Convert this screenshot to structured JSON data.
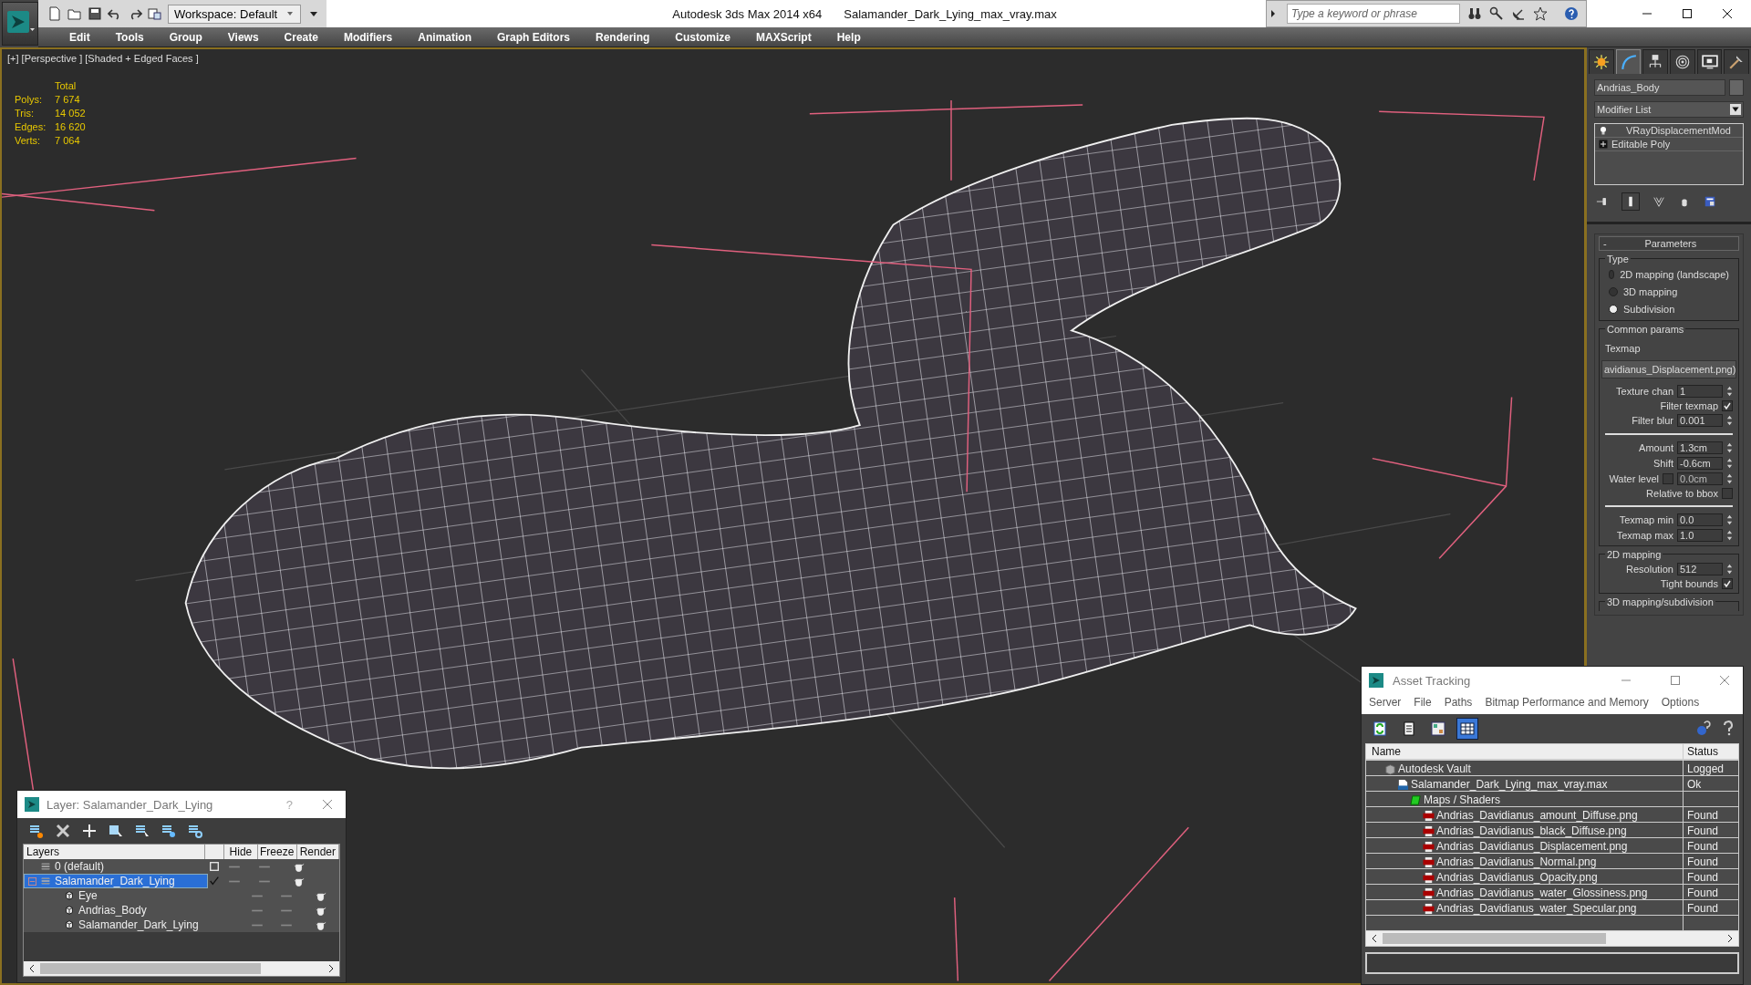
{
  "title_bar": {
    "workspace": "Workspace: Default",
    "app_title": "Autodesk 3ds Max  2014 x64",
    "file_title": "Salamander_Dark_Lying_max_vray.max",
    "search": {
      "placeholder": "Type a keyword or phrase"
    }
  },
  "menu": [
    "Edit",
    "Tools",
    "Group",
    "Views",
    "Create",
    "Modifiers",
    "Animation",
    "Graph Editors",
    "Rendering",
    "Customize",
    "MAXScript",
    "Help"
  ],
  "viewport": {
    "label": "[+] [Perspective ] [Shaded + Edged Faces ]",
    "stats": {
      "header": "Total",
      "rows": [
        {
          "label": "Polys:",
          "value": "7 674"
        },
        {
          "label": "Tris:",
          "value": "14 052"
        },
        {
          "label": "Edges:",
          "value": "16 620"
        },
        {
          "label": "Verts:",
          "value": "7 064"
        }
      ]
    }
  },
  "command_panel": {
    "tabs": [
      {
        "kind": "create",
        "selected": false
      },
      {
        "kind": "modify",
        "selected": true
      },
      {
        "kind": "hierarchy",
        "selected": false
      },
      {
        "kind": "motion",
        "selected": false
      },
      {
        "kind": "display",
        "selected": false
      },
      {
        "kind": "utilities",
        "selected": false
      }
    ],
    "object_name": "Andrias_Body",
    "modifier_list": "Modifier List",
    "stack": [
      {
        "kind": "modifier",
        "label": "VRayDisplacementMod"
      },
      {
        "kind": "base",
        "label": "Editable Poly"
      }
    ],
    "parameters": {
      "collapse": "-",
      "title": "Parameters",
      "type_group": "Type",
      "type_options": [
        {
          "label": "2D mapping (landscape)",
          "selected": false
        },
        {
          "label": "3D mapping",
          "selected": false
        },
        {
          "label": "Subdivision",
          "selected": true
        }
      ],
      "common": {
        "title": "Common params",
        "texmap_label": "Texmap",
        "texmap_value": "avidianus_Displacement.png)",
        "fields": [
          {
            "kind": "spinner",
            "label": "Texture chan",
            "value": "1"
          },
          {
            "kind": "check",
            "label": "Filter texmap",
            "checked": true
          },
          {
            "kind": "spinner",
            "label": "Filter blur",
            "value": "0.001"
          },
          {
            "kind": "rule"
          },
          {
            "kind": "spinner",
            "label": "Amount",
            "value": "1.3cm"
          },
          {
            "kind": "spinner",
            "label": "Shift",
            "value": "-0.6cm"
          },
          {
            "kind": "check_spinner",
            "label": "Water level",
            "checked": false,
            "value": "0.0cm"
          },
          {
            "kind": "check",
            "label": "Relative to bbox",
            "checked": false
          },
          {
            "kind": "rule"
          },
          {
            "kind": "spinner",
            "label": "Texmap min",
            "value": "0.0"
          },
          {
            "kind": "spinner",
            "label": "Texmap max",
            "value": "1.0"
          }
        ]
      },
      "mapping_2d": {
        "title": "2D mapping",
        "fields": [
          {
            "kind": "spinner",
            "label": "Resolution",
            "value": "512"
          },
          {
            "kind": "check",
            "label": "Tight bounds",
            "checked": true
          }
        ]
      },
      "mapping_3d": {
        "title": "3D mapping/subdivision"
      }
    }
  },
  "layer_dialog": {
    "title": "Layer: Salamander_Dark_Lying",
    "help": "?",
    "columns": {
      "layers": "Layers",
      "hide": "Hide",
      "freeze": "Freeze",
      "render": "Render"
    },
    "rows": [
      {
        "kind": "layer",
        "name": "0 (default)",
        "current": false,
        "selected": false
      },
      {
        "kind": "layer",
        "name": "Salamander_Dark_Lying",
        "current": true,
        "selected": true,
        "expanded": true,
        "children": [
          {
            "kind": "object",
            "name": "Eye",
            "selected": false
          },
          {
            "kind": "object",
            "name": "Andrias_Body",
            "selected": false
          },
          {
            "kind": "object",
            "name": "Salamander_Dark_Lying",
            "selected": false
          }
        ]
      }
    ]
  },
  "asset_tracking": {
    "title": "Asset Tracking",
    "menu": [
      "Server",
      "File",
      "Paths",
      "Bitmap Performance and Memory",
      "Options"
    ],
    "tools": [
      {
        "kind": "refresh",
        "selected": false
      },
      {
        "kind": "list",
        "selected": false
      },
      {
        "kind": "thumbnails",
        "selected": false
      },
      {
        "kind": "table",
        "selected": true
      }
    ],
    "columns": {
      "name": "Name",
      "status": "Status"
    },
    "rows": [
      {
        "kind": "vault",
        "name": "Autodesk Vault",
        "status": "Logged",
        "children": [
          {
            "kind": "max",
            "name": "Salamander_Dark_Lying_max_vray.max",
            "status": "Ok",
            "children": [
              {
                "kind": "folder",
                "name": "Maps / Shaders",
                "children": [
                  {
                    "kind": "png",
                    "name": "Andrias_Davidianus_amount_Diffuse.png",
                    "status": "Found"
                  },
                  {
                    "kind": "png",
                    "name": "Andrias_Davidianus_black_Diffuse.png",
                    "status": "Found"
                  },
                  {
                    "kind": "png",
                    "name": "Andrias_Davidianus_Displacement.png",
                    "status": "Found"
                  },
                  {
                    "kind": "png",
                    "name": "Andrias_Davidianus_Normal.png",
                    "status": "Found"
                  },
                  {
                    "kind": "png",
                    "name": "Andrias_Davidianus_Opacity.png",
                    "status": "Found"
                  },
                  {
                    "kind": "png",
                    "name": "Andrias_Davidianus_water_Glossiness.png",
                    "status": "Found"
                  },
                  {
                    "kind": "png",
                    "name": "Andrias_Davidianus_water_Specular.png",
                    "status": "Found"
                  }
                ]
              }
            ]
          }
        ]
      }
    ]
  }
}
